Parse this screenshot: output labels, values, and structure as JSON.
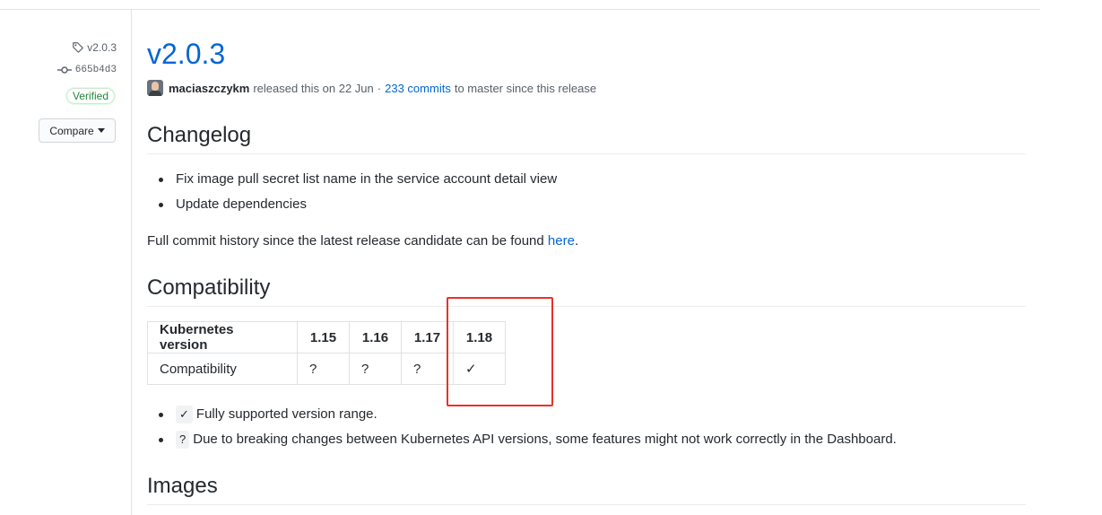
{
  "sidebar": {
    "tag": "v2.0.3",
    "commit": "665b4d3",
    "verified": "Verified",
    "compare_label": "Compare"
  },
  "release": {
    "title": "v2.0.3",
    "author": "maciaszczykm",
    "released_text": "released this on 22 Jun",
    "separator": "·",
    "commits_link": "233 commits",
    "since_text": "to master since this release"
  },
  "changelog": {
    "heading": "Changelog",
    "items": [
      "Fix image pull secret list name in the service account detail view",
      "Update dependencies"
    ],
    "history_text": "Full commit history since the latest release candidate can be found",
    "history_link": "here",
    "history_end": "."
  },
  "compatibility": {
    "heading": "Compatibility",
    "header_row": [
      "Kubernetes version",
      "1.15",
      "1.16",
      "1.17",
      "1.18"
    ],
    "value_row": [
      "Compatibility",
      "?",
      "?",
      "?",
      "✓"
    ],
    "legend": [
      {
        "symbol": "✓",
        "text": "Fully supported version range."
      },
      {
        "symbol": "?",
        "text": "Due to breaking changes between Kubernetes API versions, some features might not work correctly in the Dashboard."
      }
    ]
  },
  "images": {
    "heading": "Images"
  },
  "colors": {
    "link": "#0366d6",
    "verified": "#22863a",
    "highlight": "#e8322b"
  }
}
